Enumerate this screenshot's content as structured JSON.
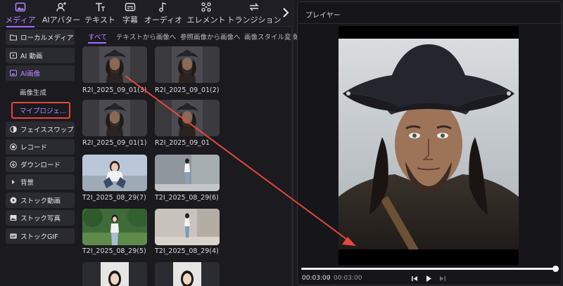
{
  "toolbar": {
    "tabs": [
      {
        "label": "メディア",
        "icon": "media-icon"
      },
      {
        "label": "AIアバター",
        "icon": "avatar-icon"
      },
      {
        "label": "テキスト",
        "icon": "text-icon"
      },
      {
        "label": "字幕",
        "icon": "caption-icon"
      },
      {
        "label": "オーディオ",
        "icon": "music-icon"
      },
      {
        "label": "エレメント",
        "icon": "element-icon"
      },
      {
        "label": "トランジション",
        "icon": "transition-icon"
      }
    ],
    "more_icon": "chevron-right-icon",
    "accent_color": "#a66cff"
  },
  "sidebar": {
    "items": [
      {
        "label": "ローカルメディア",
        "icon": "folder-icon"
      },
      {
        "label": "AI 動画",
        "icon": "ai-video-icon"
      },
      {
        "label": "AI画像",
        "icon": "ai-image-icon"
      },
      {
        "label": "フェイススワップ",
        "icon": "face-swap-icon"
      },
      {
        "label": "レコード",
        "icon": "record-icon"
      },
      {
        "label": "ダウンロード",
        "icon": "download-icon"
      },
      {
        "label": "背景",
        "icon": "triangle-right-icon"
      },
      {
        "label": "ストック動画",
        "icon": "play-icon"
      },
      {
        "label": "ストック写真",
        "icon": "photo-icon"
      },
      {
        "label": "ストックGIF",
        "icon": "gif-icon"
      }
    ],
    "sub_items": [
      "画像生成",
      "マイプロジェ…"
    ],
    "highlight_color": "#e8453c"
  },
  "subtabs": [
    "すべて",
    "テキストから画像へ",
    "参照画像から画像へ",
    "画像スタイル変換"
  ],
  "media": [
    {
      "caption": "R2I_2025_09_01(3)",
      "kind": "pirate"
    },
    {
      "caption": "R2I_2025_09_01(2)",
      "kind": "pirate"
    },
    {
      "caption": "R2I_2025_09_01(1)",
      "kind": "pirate"
    },
    {
      "caption": "R2I_2025_09_01",
      "kind": "pirate"
    },
    {
      "caption": "T2I_2025_08_29(7)",
      "kind": "girl-crouch"
    },
    {
      "caption": "T2I_2025_08_29(6)",
      "kind": "girl-stand"
    },
    {
      "caption": "T2I_2025_08_29(5)",
      "kind": "girl-park"
    },
    {
      "caption": "T2I_2025_08_29(4)",
      "kind": "girl-street"
    },
    {
      "caption": "",
      "kind": "girl-portrait"
    },
    {
      "caption": "",
      "kind": "girl-portrait"
    }
  ],
  "player": {
    "title": "プレイヤー",
    "time_current": "00:03:00",
    "time_separator": "/",
    "time_total": "00:03:00",
    "progress": 1.0,
    "controls": [
      "step-back-icon",
      "play-icon",
      "step-forward-icon"
    ]
  },
  "annotation": {
    "arrow_color": "#e8453c"
  }
}
